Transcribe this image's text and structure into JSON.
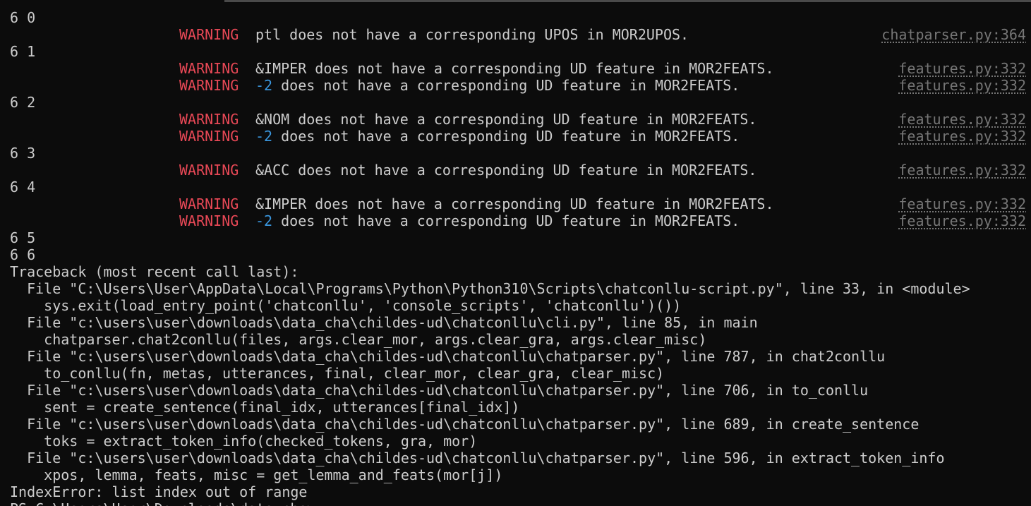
{
  "terminal": {
    "lines": [
      {
        "type": "plain",
        "text": "6 0"
      },
      {
        "type": "warning",
        "level": "WARNING",
        "token": "ptl",
        "token_style": "plain",
        "message": " does not have a corresponding UPOS in MOR2UPOS.",
        "source": "chatparser.py:364"
      },
      {
        "type": "plain",
        "text": "6 1"
      },
      {
        "type": "warning",
        "level": "WARNING",
        "token": "&IMPER",
        "token_style": "plain",
        "message": " does not have a corresponding UD feature in MOR2FEATS.",
        "source": "features.py:332"
      },
      {
        "type": "warning",
        "level": "WARNING",
        "token": "-2",
        "token_style": "number",
        "message": " does not have a corresponding UD feature in MOR2FEATS.",
        "source": "features.py:332"
      },
      {
        "type": "plain",
        "text": "6 2"
      },
      {
        "type": "warning",
        "level": "WARNING",
        "token": "&NOM",
        "token_style": "plain",
        "message": " does not have a corresponding UD feature in MOR2FEATS.",
        "source": "features.py:332"
      },
      {
        "type": "warning",
        "level": "WARNING",
        "token": "-2",
        "token_style": "number",
        "message": " does not have a corresponding UD feature in MOR2FEATS.",
        "source": "features.py:332"
      },
      {
        "type": "plain",
        "text": "6 3"
      },
      {
        "type": "warning",
        "level": "WARNING",
        "token": "&ACC",
        "token_style": "plain",
        "message": " does not have a corresponding UD feature in MOR2FEATS.",
        "source": "features.py:332"
      },
      {
        "type": "plain",
        "text": "6 4"
      },
      {
        "type": "warning",
        "level": "WARNING",
        "token": "&IMPER",
        "token_style": "plain",
        "message": " does not have a corresponding UD feature in MOR2FEATS.",
        "source": "features.py:332"
      },
      {
        "type": "warning",
        "level": "WARNING",
        "token": "-2",
        "token_style": "number",
        "message": " does not have a corresponding UD feature in MOR2FEATS.",
        "source": "features.py:332"
      },
      {
        "type": "plain",
        "text": "6 5"
      },
      {
        "type": "plain",
        "text": "6 6"
      },
      {
        "type": "plain",
        "text": "Traceback (most recent call last):"
      },
      {
        "type": "plain",
        "text": "  File \"C:\\Users\\User\\AppData\\Local\\Programs\\Python\\Python310\\Scripts\\chatconllu-script.py\", line 33, in <module>"
      },
      {
        "type": "plain",
        "text": "    sys.exit(load_entry_point('chatconllu', 'console_scripts', 'chatconllu')())"
      },
      {
        "type": "plain",
        "text": "  File \"c:\\users\\user\\downloads\\data_cha\\childes-ud\\chatconllu\\cli.py\", line 85, in main"
      },
      {
        "type": "plain",
        "text": "    chatparser.chat2conllu(files, args.clear_mor, args.clear_gra, args.clear_misc)"
      },
      {
        "type": "plain",
        "text": "  File \"c:\\users\\user\\downloads\\data_cha\\childes-ud\\chatconllu\\chatparser.py\", line 787, in chat2conllu"
      },
      {
        "type": "plain",
        "text": "    to_conllu(fn, metas, utterances, final, clear_mor, clear_gra, clear_misc)"
      },
      {
        "type": "plain",
        "text": "  File \"c:\\users\\user\\downloads\\data_cha\\childes-ud\\chatconllu\\chatparser.py\", line 706, in to_conllu"
      },
      {
        "type": "plain",
        "text": "    sent = create_sentence(final_idx, utterances[final_idx])"
      },
      {
        "type": "plain",
        "text": "  File \"c:\\users\\user\\downloads\\data_cha\\childes-ud\\chatconllu\\chatparser.py\", line 689, in create_sentence"
      },
      {
        "type": "plain",
        "text": "    toks = extract_token_info(checked_tokens, gra, mor)"
      },
      {
        "type": "plain",
        "text": "  File \"c:\\users\\user\\downloads\\data_cha\\childes-ud\\chatconllu\\chatparser.py\", line 596, in extract_token_info"
      },
      {
        "type": "plain",
        "text": "    xpos, lemma, feats, misc = get_lemma_and_feats(mor[j])"
      },
      {
        "type": "plain",
        "text": "IndexError: list index out of range"
      },
      {
        "type": "prompt",
        "text": "PS C:\\Users\\User\\Downloads\\data_cha>"
      }
    ]
  },
  "colors": {
    "background": "#0c0c0c",
    "foreground": "#cccccc",
    "warning": "#e74856",
    "number": "#3a96dd",
    "source_link": "#767676"
  }
}
